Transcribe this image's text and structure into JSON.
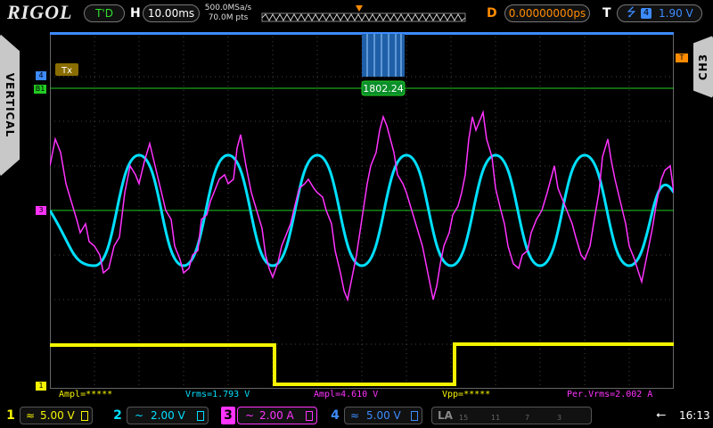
{
  "brand": "RIGOL",
  "trigger_status": "T'D",
  "timebase": {
    "label": "H",
    "value": "10.00ms"
  },
  "acquisition": {
    "sample_rate": "500.0MSa/s",
    "points": "70.0M pts"
  },
  "delay": {
    "label": "D",
    "value": "0.00000000ps"
  },
  "trigger": {
    "label": "T",
    "source": "4",
    "level": "1.90 V"
  },
  "side_tabs": {
    "left": "VERTICAL",
    "right": "CH3"
  },
  "decode": {
    "label": "Tx",
    "value": "1802.24"
  },
  "markers": {
    "ch4": "4",
    "b1": "B1",
    "ch3": "3",
    "ch1": "1",
    "trig": "T"
  },
  "measurements": [
    {
      "text": "Ampl=*****",
      "color": "#f5f500"
    },
    {
      "text": "Vrms=1.793 V",
      "color": "#00e0ff"
    },
    {
      "text": "Ampl=4.610 V",
      "color": "#ff33ff"
    },
    {
      "text": "Vpp=*****",
      "color": "#f5f500"
    },
    {
      "text": "Per.Vrms=2.002 A",
      "color": "#ff33ff"
    }
  ],
  "channels": [
    {
      "num": "1",
      "coupling": "≈",
      "scale": "5.00 V",
      "color": "#f5f500"
    },
    {
      "num": "2",
      "coupling": "~",
      "scale": "2.00 V",
      "color": "#00e0ff"
    },
    {
      "num": "3",
      "coupling": "~",
      "scale": "2.00 A",
      "color": "#ff33ff"
    },
    {
      "num": "4",
      "coupling": "≈",
      "scale": "5.00 V",
      "color": "#3d8bff"
    }
  ],
  "la": {
    "label": "LA",
    "groups": [
      "15",
      "11",
      "7",
      "3"
    ]
  },
  "status": {
    "time": "16:13",
    "usb_icon": "usb-icon"
  },
  "colors": {
    "ch1": "#f5f500",
    "ch2": "#00e0ff",
    "ch3": "#ff33ff",
    "ch4": "#3d8bff",
    "bus": "#22cc22",
    "trigger": "#ff8c00"
  }
}
